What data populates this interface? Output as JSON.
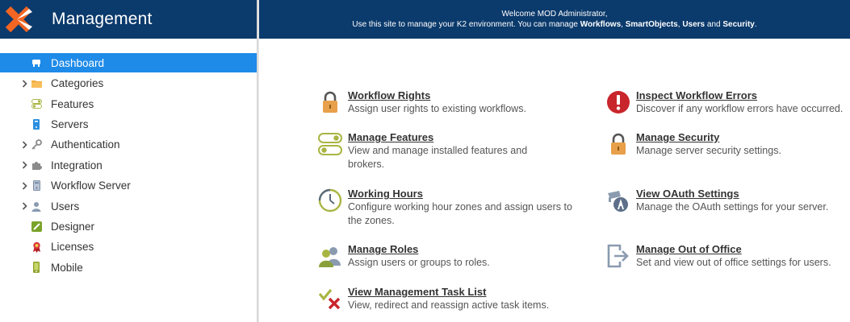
{
  "sidebar": {
    "title": "Management",
    "items": [
      {
        "label": "Dashboard",
        "icon": "dashboard-icon",
        "expandable": false,
        "active": true
      },
      {
        "label": "Categories",
        "icon": "folder-icon",
        "expandable": true,
        "active": false
      },
      {
        "label": "Features",
        "icon": "toggle-icon",
        "expandable": false,
        "active": false
      },
      {
        "label": "Servers",
        "icon": "server-icon",
        "expandable": false,
        "active": false
      },
      {
        "label": "Authentication",
        "icon": "key-icon",
        "expandable": true,
        "active": false
      },
      {
        "label": "Integration",
        "icon": "puzzle-icon",
        "expandable": true,
        "active": false
      },
      {
        "label": "Workflow Server",
        "icon": "workflow-server-icon",
        "expandable": true,
        "active": false
      },
      {
        "label": "Users",
        "icon": "user-icon",
        "expandable": true,
        "active": false
      },
      {
        "label": "Designer",
        "icon": "designer-icon",
        "expandable": false,
        "active": false
      },
      {
        "label": "Licenses",
        "icon": "ribbon-icon",
        "expandable": false,
        "active": false
      },
      {
        "label": "Mobile",
        "icon": "mobile-icon",
        "expandable": false,
        "active": false
      }
    ]
  },
  "banner": {
    "welcome": "Welcome MOD Administrator,",
    "intro": "Use this site to manage your K2 environment. You can manage ",
    "workflows": "Workflows",
    "sep1": ", ",
    "smartobjects": "SmartObjects",
    "sep2": ", ",
    "users": "Users",
    "and": " and ",
    "security": "Security",
    "end": "."
  },
  "tasks": {
    "workflow_rights": {
      "title": "Workflow Rights",
      "desc": "Assign user rights to existing workflows."
    },
    "manage_features": {
      "title": "Manage Features",
      "desc": "View and manage installed features and brokers."
    },
    "working_hours": {
      "title": "Working Hours",
      "desc": "Configure working hour zones and assign users to the zones."
    },
    "manage_roles": {
      "title": "Manage Roles",
      "desc": "Assign users or groups to roles."
    },
    "task_list": {
      "title": "View Management Task List",
      "desc": "View, redirect and reassign active task items."
    },
    "inspect_errors": {
      "title": "Inspect Workflow Errors",
      "desc": "Discover if any workflow errors have occurred."
    },
    "manage_security": {
      "title": "Manage Security",
      "desc": "Manage server security settings."
    },
    "oauth": {
      "title": "View OAuth Settings",
      "desc": "Manage the OAuth settings for your server."
    },
    "out_of_office": {
      "title": "Manage Out of Office",
      "desc": "Set and view out of office settings for users."
    }
  },
  "colors": {
    "header_bg": "#0b3a6c",
    "active_bg": "#1e8be8",
    "lock_orange": "#e8a04a",
    "error_red": "#c9252c",
    "olive": "#a9b542"
  }
}
